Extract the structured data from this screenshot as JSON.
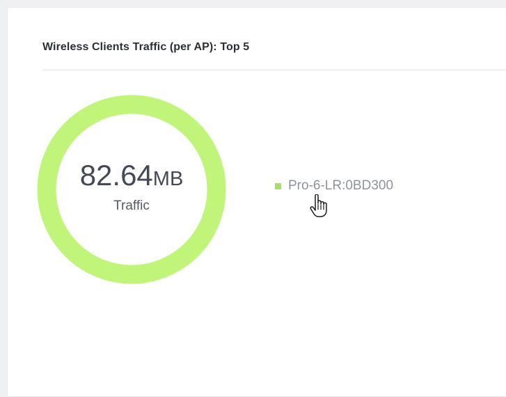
{
  "widget": {
    "title": "Wireless Clients Traffic (per AP): Top 5"
  },
  "donut": {
    "value": "82.64",
    "unit": "MB",
    "label": "Traffic",
    "ring_color": "#c1f57a"
  },
  "legend": {
    "items": [
      {
        "label": "Pro-6-LR:0BD300",
        "color": "#a6e06a"
      }
    ]
  },
  "chart_data": {
    "type": "pie",
    "categories": [
      "Pro-6-LR:0BD300"
    ],
    "values": [
      82.64
    ],
    "title": "",
    "center_text": "82.64MB",
    "center_subtext": "Traffic"
  },
  "icons": {
    "cursor": "hand-pointer-icon"
  }
}
